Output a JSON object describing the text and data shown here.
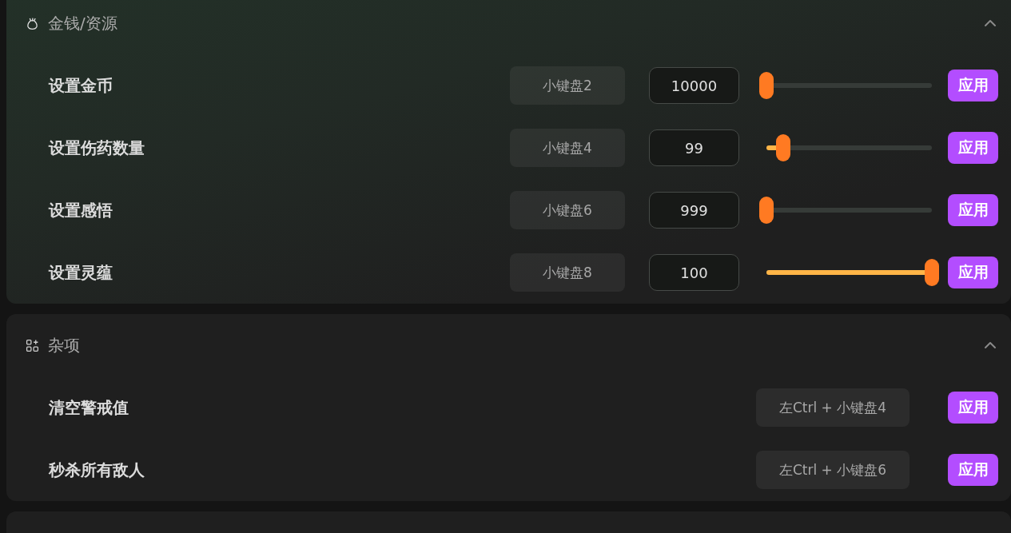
{
  "sections": [
    {
      "title": "金钱/资源",
      "expanded": true,
      "rows": [
        {
          "kind": "slider",
          "label": "设置金币",
          "hotkey": "小键盘2",
          "value": "10000",
          "level": 0,
          "button": "应用"
        },
        {
          "kind": "slider",
          "label": "设置伤药数量",
          "hotkey": "小键盘4",
          "value": "99",
          "level": 0.1,
          "button": "应用"
        },
        {
          "kind": "slider",
          "label": "设置感悟",
          "hotkey": "小键盘6",
          "value": "999",
          "level": 0,
          "button": "应用"
        },
        {
          "kind": "slider",
          "label": "设置灵蕴",
          "hotkey": "小键盘8",
          "value": "100",
          "level": 1,
          "button": "应用"
        }
      ]
    },
    {
      "title": "杂项",
      "expanded": true,
      "rows": [
        {
          "kind": "action",
          "label": "清空警戒值",
          "hotkey": "左Ctrl + 小键盘4",
          "button": "应用"
        },
        {
          "kind": "action",
          "label": "秒杀所有敌人",
          "hotkey": "左Ctrl + 小键盘6",
          "button": "应用"
        }
      ]
    }
  ]
}
